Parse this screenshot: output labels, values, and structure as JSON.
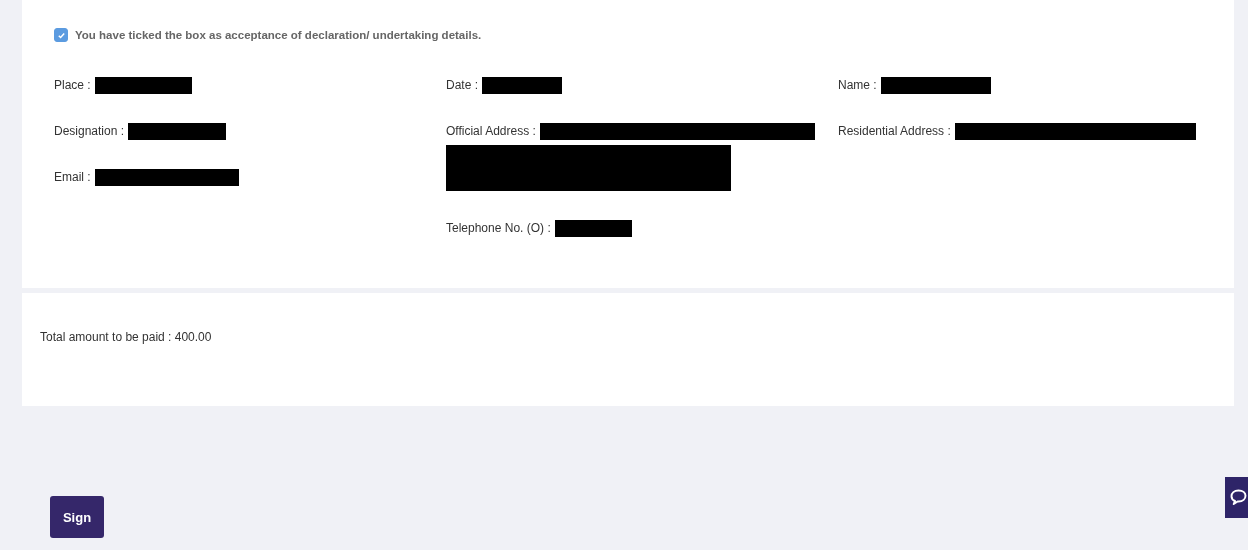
{
  "declaration": {
    "checked": true,
    "text": "You have ticked the box as acceptance of declaration/ undertaking details."
  },
  "columns": [
    {
      "fields": [
        {
          "label": "Place :",
          "redacted": true
        },
        {
          "label": "Designation :",
          "redacted": true
        },
        {
          "label": "Email :",
          "redacted": true
        }
      ]
    },
    {
      "fields": [
        {
          "label": "Date :",
          "redacted": true
        },
        {
          "label": "Official Address :",
          "redacted": true,
          "wrapped": true
        },
        {
          "label": "Telephone No. (O) :",
          "redacted": true
        }
      ]
    },
    {
      "fields": [
        {
          "label": "Name :",
          "redacted": true
        },
        {
          "label": "Residential Address :",
          "redacted": true
        }
      ]
    }
  ],
  "total": {
    "text": "Total amount to be paid : 400.00"
  },
  "sign_button": {
    "label": "Sign"
  }
}
